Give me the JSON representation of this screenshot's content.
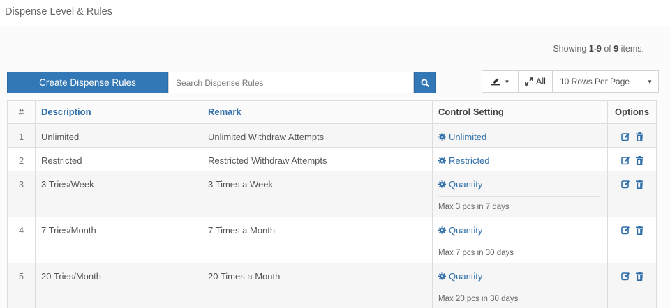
{
  "page": {
    "title": "Dispense Level & Rules"
  },
  "summary": {
    "prefix": "Showing ",
    "range": "1-9",
    "middle": " of ",
    "total": "9",
    "suffix": " items."
  },
  "toolbar": {
    "create_label": "Create Dispense Rules",
    "search_placeholder": "Search Dispense Rules",
    "search_icon": "search-icon",
    "export_icon": "export-icon",
    "all_label": "All",
    "rows_per_page": "10 Rows Per Page"
  },
  "table": {
    "headers": {
      "num": "#",
      "description": "Description",
      "remark": "Remark",
      "control": "Control Setting",
      "options": "Options"
    },
    "rows": [
      {
        "num": "1",
        "description": "Unlimited",
        "remark": "Unlimited Withdraw Attempts",
        "control": "Unlimited",
        "note": ""
      },
      {
        "num": "2",
        "description": "Restricted",
        "remark": "Restricted Withdraw Attempts",
        "control": "Restricted",
        "note": ""
      },
      {
        "num": "3",
        "description": "3 Tries/Week",
        "remark": "3 Times a Week",
        "control": "Quantity",
        "note": "Max 3 pcs in 7 days"
      },
      {
        "num": "4",
        "description": "7 Tries/Month",
        "remark": "7 Times a Month",
        "control": "Quantity",
        "note": "Max 7 pcs in 30 days"
      },
      {
        "num": "5",
        "description": "20 Tries/Month",
        "remark": "20 Times a Month",
        "control": "Quantity",
        "note": "Max 20 pcs in 30 days"
      }
    ]
  },
  "colors": {
    "primary": "#3378b6",
    "link": "#2f6ea8"
  }
}
